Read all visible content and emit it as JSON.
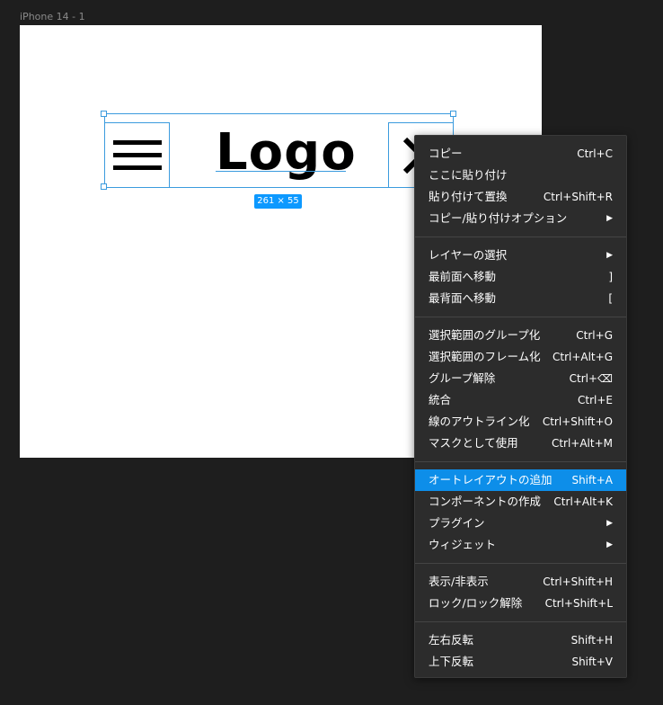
{
  "frame": {
    "label": "iPhone 14 - 1"
  },
  "design": {
    "logo_text": "Logo",
    "size_badge": "261 × 55",
    "accent": "#3b9bde"
  },
  "context_menu": {
    "highlight_color": "#0d8ee9",
    "groups": [
      [
        {
          "label": "コピー",
          "shortcut": "Ctrl+C"
        },
        {
          "label": "ここに貼り付け",
          "shortcut": ""
        },
        {
          "label": "貼り付けて置換",
          "shortcut": "Ctrl+Shift+R"
        },
        {
          "label": "コピー/貼り付けオプション",
          "shortcut": "▶"
        }
      ],
      [
        {
          "label": "レイヤーの選択",
          "shortcut": "▶"
        },
        {
          "label": "最前面へ移動",
          "shortcut": "]"
        },
        {
          "label": "最背面へ移動",
          "shortcut": "["
        }
      ],
      [
        {
          "label": "選択範囲のグループ化",
          "shortcut": "Ctrl+G"
        },
        {
          "label": "選択範囲のフレーム化",
          "shortcut": "Ctrl+Alt+G"
        },
        {
          "label": "グループ解除",
          "shortcut": "Ctrl+⌫"
        },
        {
          "label": "統合",
          "shortcut": "Ctrl+E"
        },
        {
          "label": "線のアウトライン化",
          "shortcut": "Ctrl+Shift+O"
        },
        {
          "label": "マスクとして使用",
          "shortcut": "Ctrl+Alt+M"
        }
      ],
      [
        {
          "label": "オートレイアウトの追加",
          "shortcut": "Shift+A"
        },
        {
          "label": "コンポーネントの作成",
          "shortcut": "Ctrl+Alt+K"
        },
        {
          "label": "プラグイン",
          "shortcut": "▶"
        },
        {
          "label": "ウィジェット",
          "shortcut": "▶"
        }
      ],
      [
        {
          "label": "表示/非表示",
          "shortcut": "Ctrl+Shift+H"
        },
        {
          "label": "ロック/ロック解除",
          "shortcut": "Ctrl+Shift+L"
        }
      ],
      [
        {
          "label": "左右反転",
          "shortcut": "Shift+H"
        },
        {
          "label": "上下反転",
          "shortcut": "Shift+V"
        }
      ]
    ]
  }
}
